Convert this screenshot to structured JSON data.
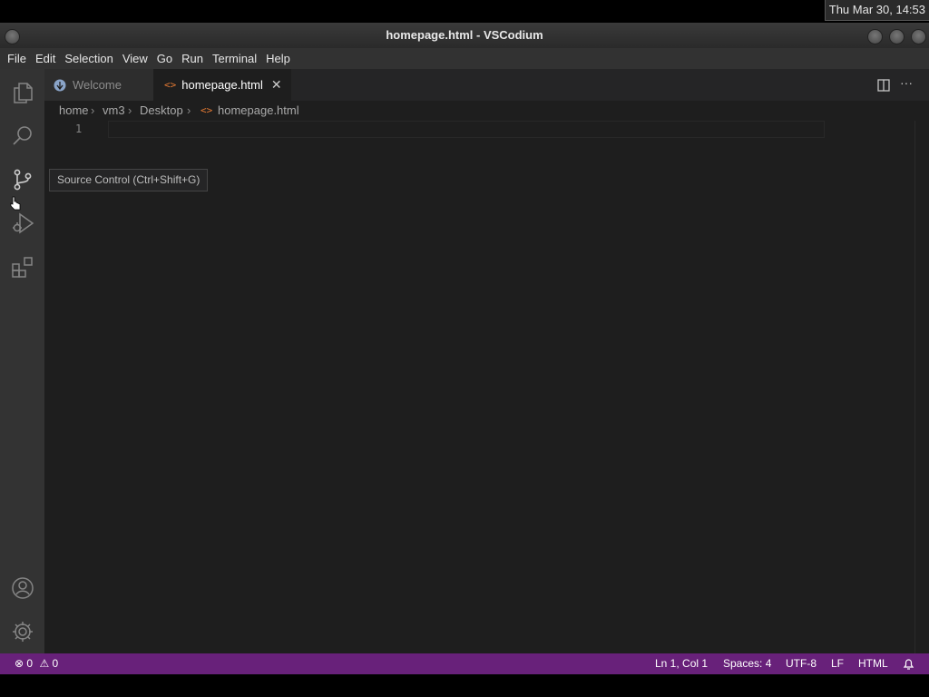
{
  "system": {
    "clock": "Thu Mar 30, 14:53"
  },
  "window": {
    "title": "homepage.html - VSCodium"
  },
  "menu": [
    "File",
    "Edit",
    "Selection",
    "View",
    "Go",
    "Run",
    "Terminal",
    "Help"
  ],
  "tabs": [
    {
      "label": "Welcome",
      "active": false
    },
    {
      "label": "homepage.html",
      "active": true
    }
  ],
  "breadcrumbs": [
    "home",
    "vm3",
    "Desktop",
    "homepage.html"
  ],
  "editor": {
    "line_numbers": [
      "1"
    ]
  },
  "tooltip": {
    "text": "Source Control (Ctrl+Shift+G)"
  },
  "statusbar": {
    "errors": "0",
    "warnings": "0",
    "position": "Ln 1, Col 1",
    "indent": "Spaces: 4",
    "encoding": "UTF-8",
    "eol": "LF",
    "language": "HTML"
  },
  "colors": {
    "statusbar": "#68217a",
    "editor_bg": "#1e1e1e",
    "activity_bg": "#333333"
  }
}
